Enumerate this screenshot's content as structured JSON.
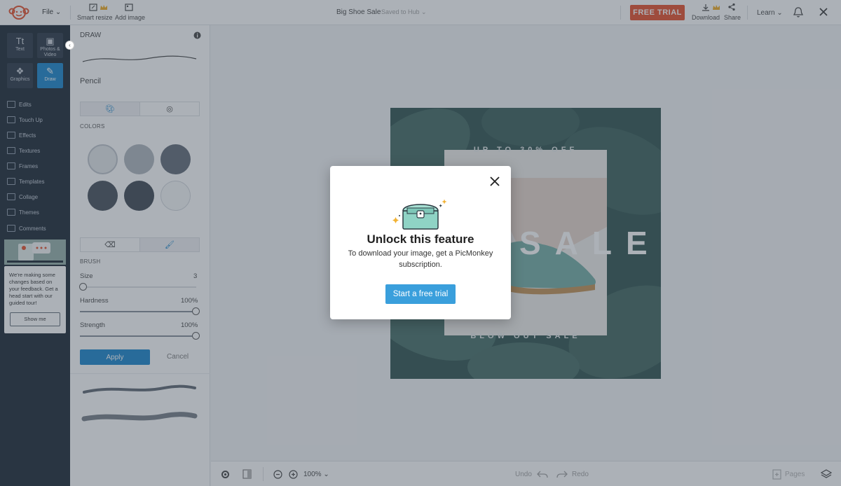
{
  "topbar": {
    "file_menu": "File",
    "smart_resize": "Smart resize",
    "add_image": "Add image",
    "doc_title": "Big Shoe Sale",
    "saved_status": "Saved to Hub",
    "free_trial": "FREE TRIAL",
    "download": "Download",
    "share": "Share",
    "learn": "Learn"
  },
  "rail": {
    "tiles": {
      "text": "Text",
      "text_glyph": "Tt",
      "photos": "Photos & Video",
      "graphics": "Graphics",
      "draw": "Draw"
    },
    "items": [
      "Edits",
      "Touch Up",
      "Effects",
      "Textures",
      "Frames",
      "Templates",
      "Collage",
      "Themes",
      "Comments"
    ],
    "promo_text": "We're making some changes based on your feedback. Get a head start with our guided tour!",
    "promo_button": "Show me"
  },
  "panel": {
    "title": "DRAW",
    "tool_name": "Pencil",
    "colors_label": "COLORS",
    "swatches": [
      "#f2f3f5",
      "#cfd3d8",
      "#9aa0a8",
      "#8e949c",
      "#8b9199",
      "#ffffff"
    ],
    "brush_label": "BRUSH",
    "size_label": "Size",
    "size_value": "3",
    "size_level": 0.03,
    "hardness_label": "Hardness",
    "hardness_value": "100%",
    "hardness_level": 1.0,
    "strength_label": "Strength",
    "strength_value": "100%",
    "strength_level": 1.0,
    "apply": "Apply",
    "cancel": "Cancel"
  },
  "artboard": {
    "top_text": "UP TO 30% OFF",
    "headline": "SALE",
    "bottom_text": "BLOW OUT SALE"
  },
  "bottombar": {
    "zoom": "100%",
    "undo": "Undo",
    "redo": "Redo",
    "pages": "Pages"
  },
  "modal": {
    "title": "Unlock this feature",
    "body": "To download your image, get a PicMonkey subscription.",
    "cta": "Start a free trial"
  },
  "colors": {
    "accent": "#3a9fdc",
    "trial": "#e85d3a",
    "rail": "#2d3743"
  }
}
